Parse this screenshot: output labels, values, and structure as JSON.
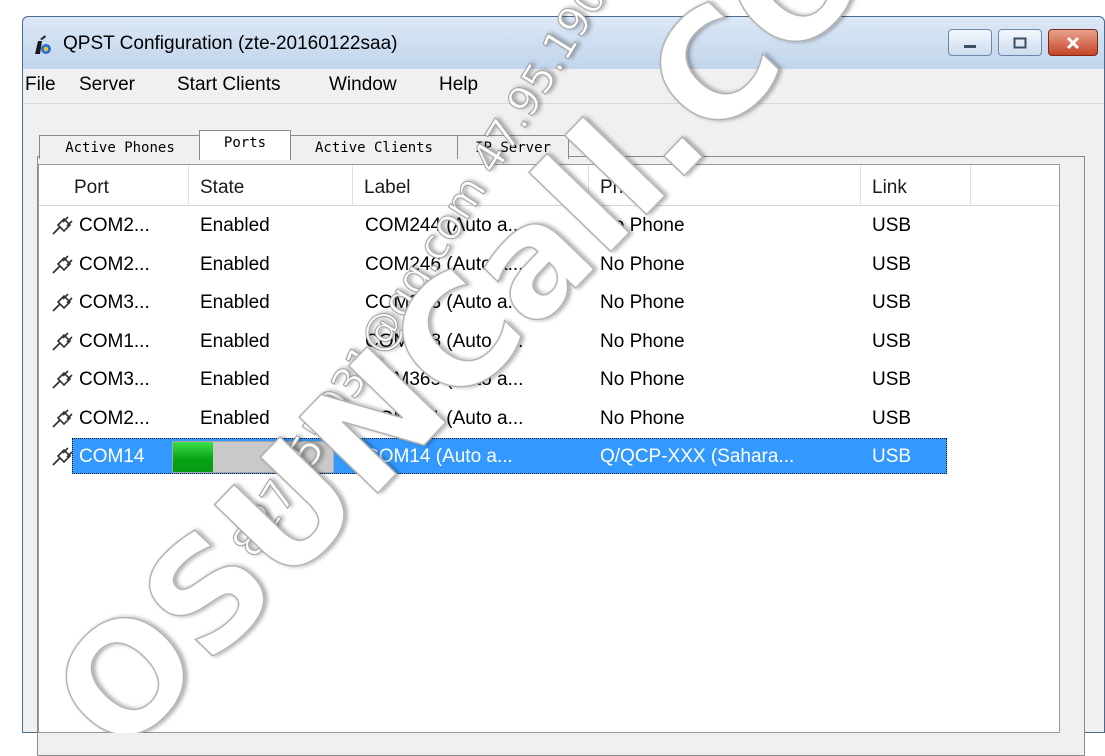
{
  "window": {
    "title": "QPST Configuration (zte-20160122saa)",
    "buttons": {
      "minimize": "minimize-icon",
      "maximize": "maximize-icon",
      "close": "close-icon"
    }
  },
  "menu": {
    "items": [
      "File",
      "Server",
      "Start Clients",
      "Window",
      "Help"
    ]
  },
  "tabs": [
    {
      "label": "Active Phones",
      "selected": false
    },
    {
      "label": "Ports",
      "selected": true
    },
    {
      "label": "Active Clients",
      "selected": false
    },
    {
      "label": "IP Server",
      "selected": false
    }
  ],
  "ports_table": {
    "columns": [
      "Port",
      "State",
      "Label",
      "Phone",
      "Link"
    ],
    "rows": [
      {
        "port": "COM2...",
        "state": "Enabled",
        "label": "COM244 (Auto a...",
        "phone": "No Phone",
        "link": "USB"
      },
      {
        "port": "COM2...",
        "state": "Enabled",
        "label": "COM246 (Auto a...",
        "phone": "No Phone",
        "link": "USB"
      },
      {
        "port": "COM3...",
        "state": "Enabled",
        "label": "COM343 (Auto a...",
        "phone": "No Phone",
        "link": "USB"
      },
      {
        "port": "COM1...",
        "state": "Enabled",
        "label": "COM198 (Auto a...",
        "phone": "No Phone",
        "link": "USB"
      },
      {
        "port": "COM3...",
        "state": "Enabled",
        "label": "COM365 (Auto a...",
        "phone": "No Phone",
        "link": "USB"
      },
      {
        "port": "COM2...",
        "state": "Enabled",
        "label": "COM261 (Auto a...",
        "phone": "No Phone",
        "link": "USB"
      },
      {
        "port": "COM14",
        "state_progress": 0.25,
        "label": "COM14 (Auto a...",
        "phone": "Q/QCP-XXX (Sahara...",
        "link": "USB",
        "selected": true
      }
    ]
  },
  "colors": {
    "selection": "#3399ff",
    "progress_fill": "#06a814",
    "titlebar": "#c2d5ec",
    "close_button": "#c64528"
  },
  "watermark": {
    "lines": [
      "827455031@qq.com 47.95.190.66",
      "OSUNCall.COM.CN"
    ]
  }
}
